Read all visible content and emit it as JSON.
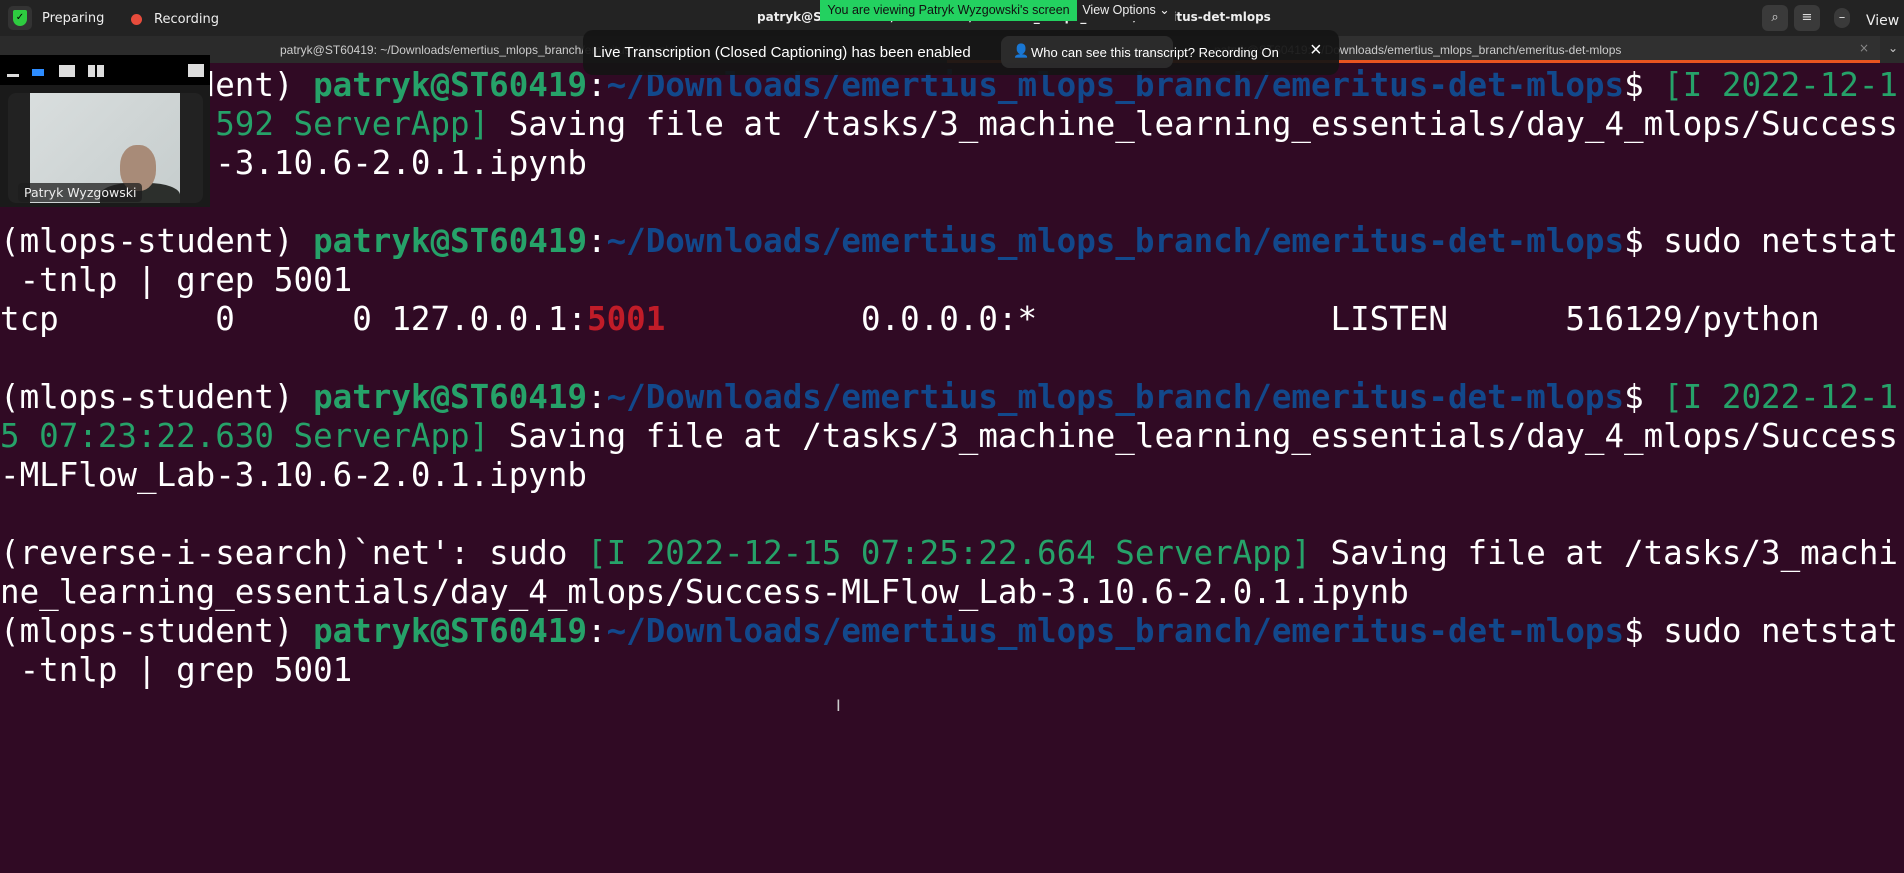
{
  "topbar": {
    "preparing": "Preparing",
    "recording": "Recording",
    "title": "patryk@ST60419: ~/Downloads/emertius_mlops_branch/emeritus-det-mlops",
    "viewing": "You are viewing Patryk Wyzgowski's screen",
    "view_options": "View Options",
    "view": "View"
  },
  "tabs": [
    {
      "label": "patryk@ST60419: ~/Downloads/emertius_mlops_branch/emeritus-det-mlops"
    },
    {
      "label": "patryk@ST60419: ~/Downloads/emertius_mlops_branch/emeritus-det-mlops"
    }
  ],
  "caption": {
    "message": "Live Transcription (Closed Captioning) has been enabled",
    "who": "Who can see this transcript? Recording On"
  },
  "video": {
    "name": "Patryk Wyzgowski"
  },
  "terminal": {
    "rows": [
      [
        [
          "w",
          "(mlops-student) "
        ],
        [
          "g",
          "patryk@ST60419"
        ],
        [
          "w",
          ":"
        ],
        [
          "b",
          "~/Downloads/emertius_mlops_branch/emeritus-det-mlops"
        ],
        [
          "w",
          "$ "
        ],
        [
          "gn",
          "[I 2022-12-1"
        ]
      ],
      [
        [
          "w",
          "           "
        ],
        [
          "gn",
          "592 ServerApp]"
        ],
        [
          "w",
          " Saving file at /tasks/3_machine_learning_essentials/day_4_mlops/Success"
        ]
      ],
      [
        [
          "w",
          "           -3.10.6-2.0.1.ipynb"
        ]
      ],
      [
        [
          "w",
          ""
        ]
      ],
      [
        [
          "w",
          "(mlops-student) "
        ],
        [
          "g",
          "patryk@ST60419"
        ],
        [
          "w",
          ":"
        ],
        [
          "b",
          "~/Downloads/emertius_mlops_branch/emeritus-det-mlops"
        ],
        [
          "w",
          "$ sudo netstat"
        ]
      ],
      [
        [
          "w",
          " -tnlp | grep 5001"
        ]
      ],
      [
        [
          "w",
          "tcp        0      0 127.0.0.1:"
        ],
        [
          "r",
          "5001"
        ],
        [
          "w",
          "          0.0.0.0:*               LISTEN      516129/python"
        ]
      ],
      [
        [
          "w",
          ""
        ]
      ],
      [
        [
          "w",
          "(mlops-student) "
        ],
        [
          "g",
          "patryk@ST60419"
        ],
        [
          "w",
          ":"
        ],
        [
          "b",
          "~/Downloads/emertius_mlops_branch/emeritus-det-mlops"
        ],
        [
          "w",
          "$ "
        ],
        [
          "gn",
          "[I 2022-12-1"
        ]
      ],
      [
        [
          "gn",
          "5 07:23:22.630 ServerApp]"
        ],
        [
          "w",
          " Saving file at /tasks/3_machine_learning_essentials/day_4_mlops/Success"
        ]
      ],
      [
        [
          "w",
          "-MLFlow_Lab-3.10.6-2.0.1.ipynb"
        ]
      ],
      [
        [
          "w",
          ""
        ]
      ],
      [
        [
          "w",
          "(reverse-i-search)`net': sudo "
        ],
        [
          "gn",
          "[I 2022-12-15 07:25:22.664 ServerApp]"
        ],
        [
          "w",
          " Saving file at /tasks/3_machi"
        ]
      ],
      [
        [
          "w",
          "ne_learning_essentials/day_4_mlops/Success-MLFlow_Lab-3.10.6-2.0.1.ipynb"
        ]
      ],
      [
        [
          "w",
          "(mlops-student) "
        ],
        [
          "g",
          "patryk@ST60419"
        ],
        [
          "w",
          ":"
        ],
        [
          "b",
          "~/Downloads/emertius_mlops_branch/emeritus-det-mlops"
        ],
        [
          "w",
          "$ sudo netstat"
        ]
      ],
      [
        [
          "w",
          " -tnlp | grep 5001"
        ]
      ]
    ]
  },
  "colors": {
    "bg": "#300a24",
    "green": "#26a269",
    "blue": "#12488b",
    "red": "#c01c28"
  }
}
